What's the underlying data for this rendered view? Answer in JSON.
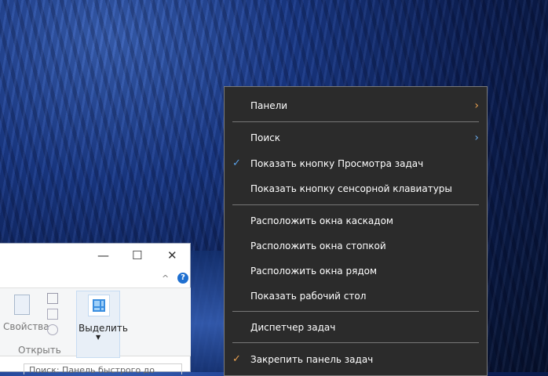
{
  "explorer": {
    "minimize": "—",
    "maximize": "☐",
    "close": "✕",
    "help": "?",
    "collapse": "^",
    "properties_label": "Свойства",
    "open_group_label": "Открыть",
    "select_label": "Выделить",
    "search_placeholder": "Поиск: Панель быстрого до"
  },
  "menu": {
    "items": [
      {
        "label": "Панели",
        "submenu": true,
        "chevron_color": "#e8a050"
      },
      {
        "label": "Поиск",
        "submenu": true,
        "chevron_color": "#6aa8e8"
      },
      {
        "label": "Показать кнопку Просмотра задач",
        "checked": true,
        "check_color": "#5aa0e6"
      },
      {
        "label": "Показать кнопку сенсорной клавиатуры"
      },
      {
        "label": "Расположить окна каскадом"
      },
      {
        "label": "Расположить окна стопкой"
      },
      {
        "label": "Расположить окна рядом"
      },
      {
        "label": "Показать рабочий стол"
      },
      {
        "label": "Диспетчер задач"
      },
      {
        "label": "Закрепить панель задач",
        "checked": true,
        "check_color": "#e8a050"
      }
    ]
  }
}
